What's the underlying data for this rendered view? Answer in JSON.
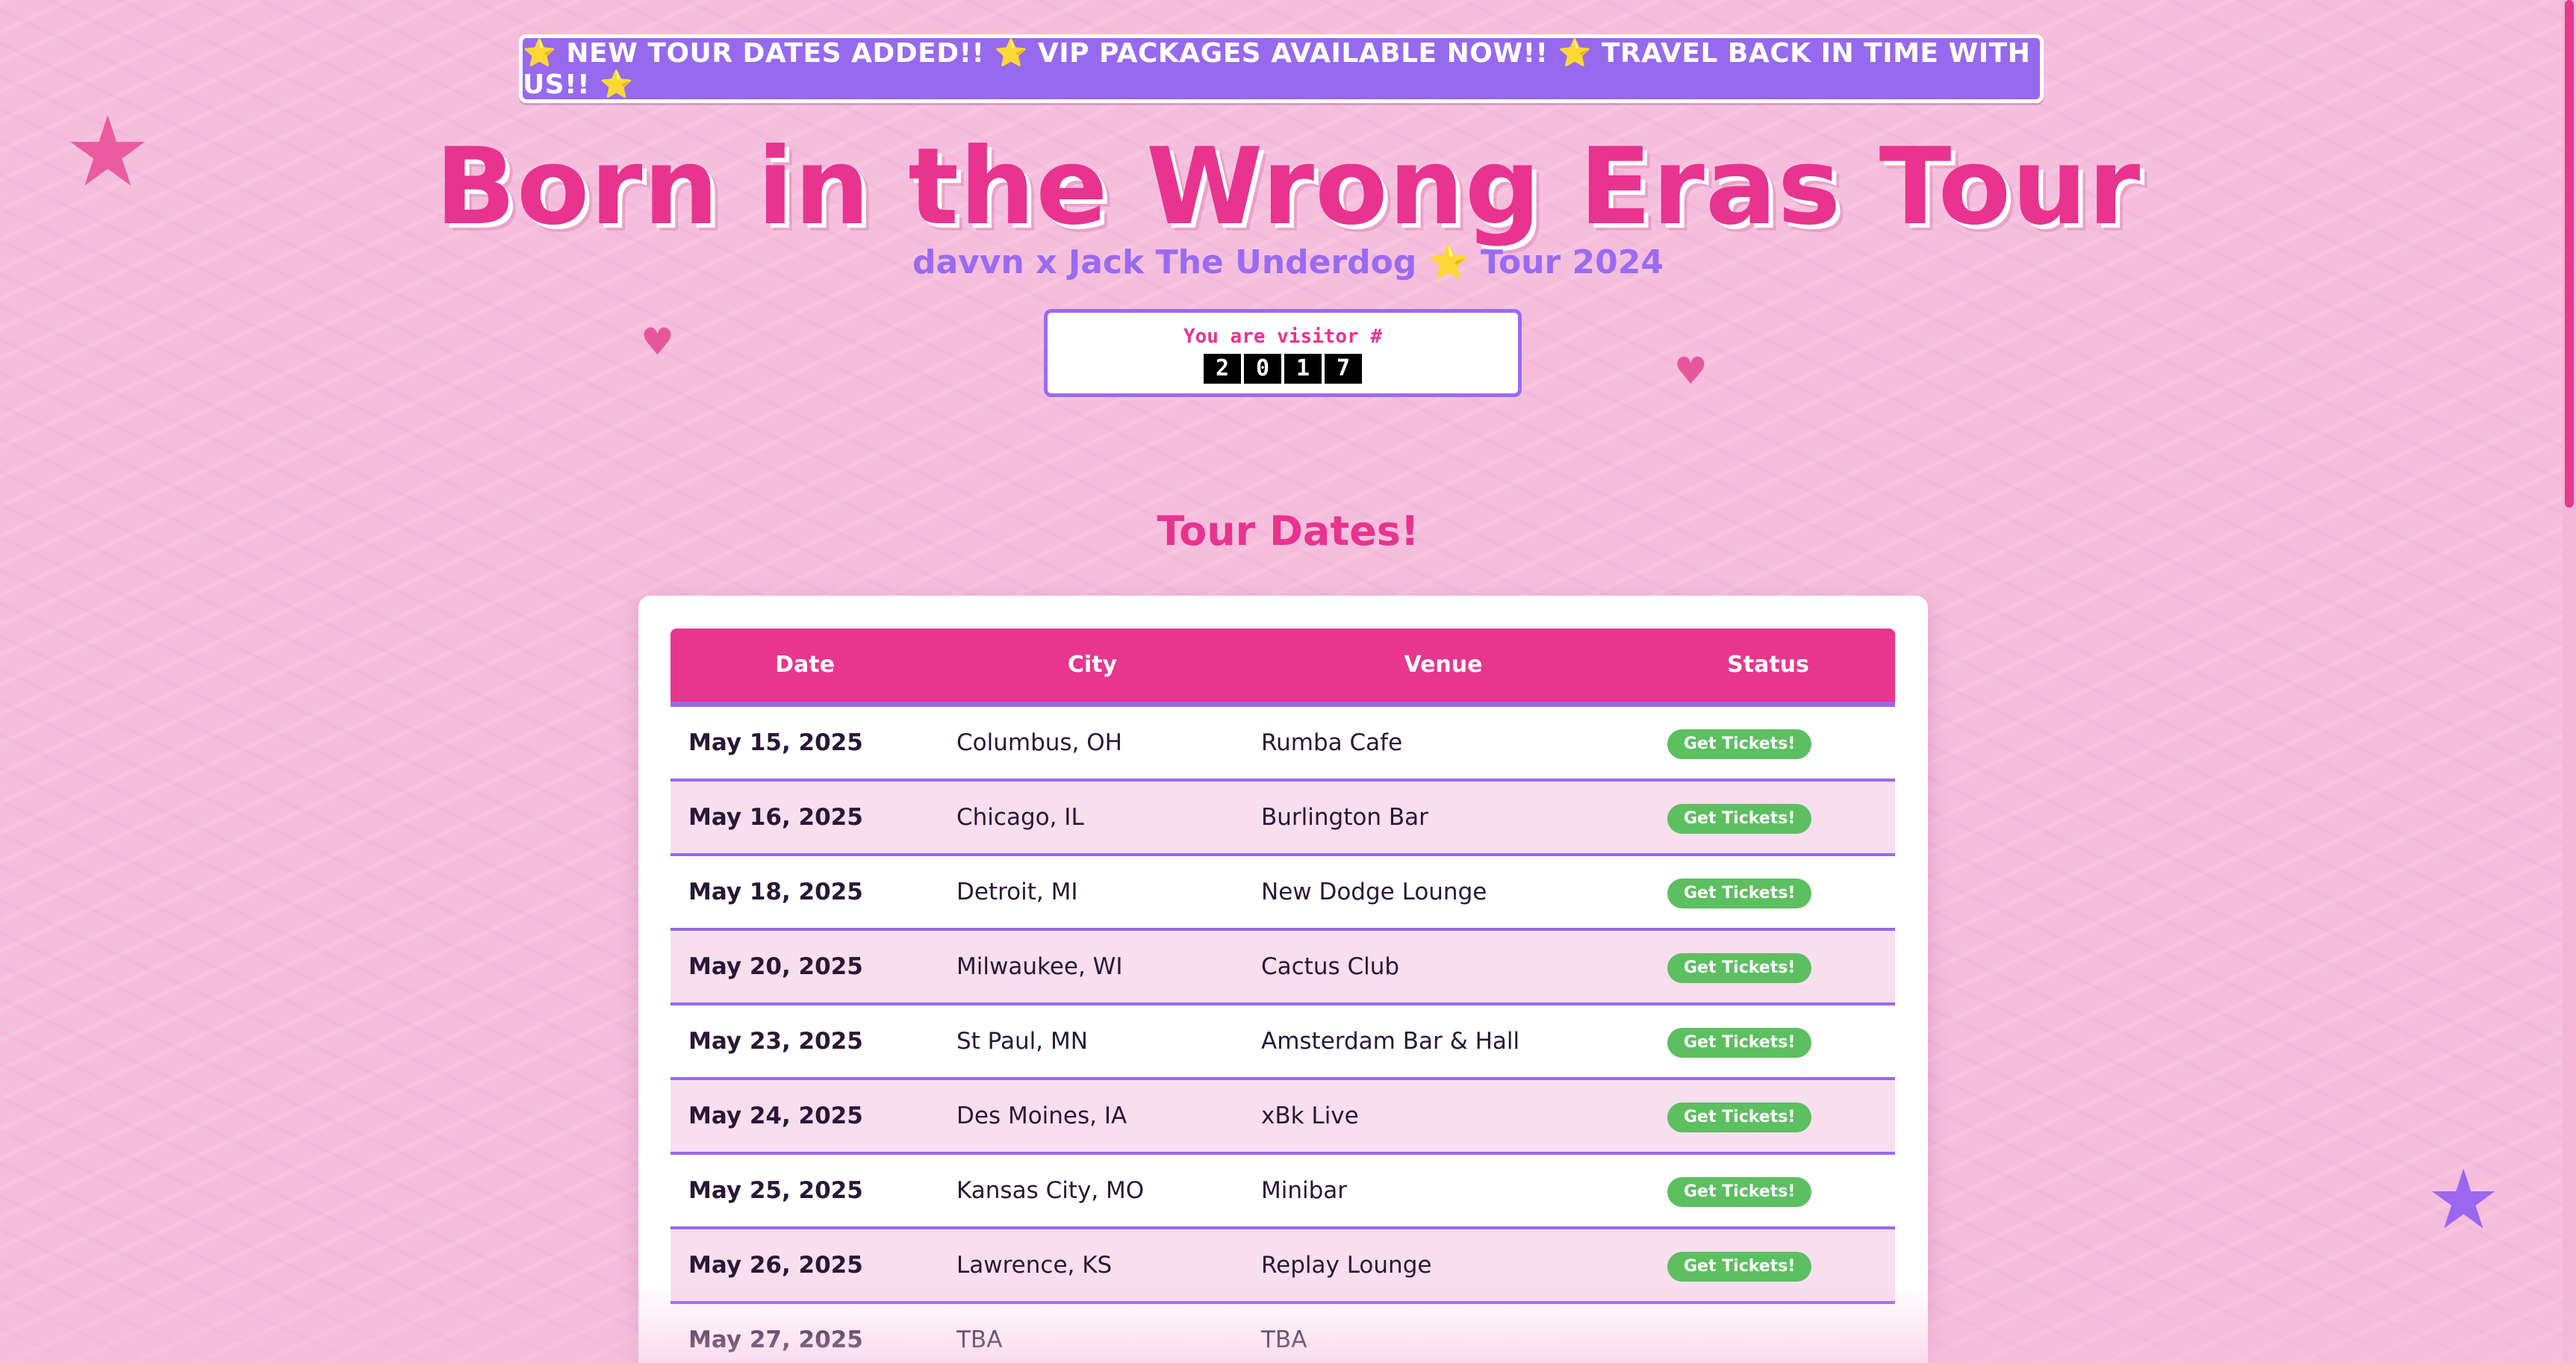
{
  "banner": {
    "text": "⭐ NEW TOUR DATES ADDED!! ⭐ VIP PACKAGES AVAILABLE NOW!! ⭐ TRAVEL BACK IN TIME WITH US!! ⭐"
  },
  "header": {
    "title": "Born in the Wrong Eras Tour",
    "subtitle": "davvn x Jack The Underdog ⭐ Tour 2024"
  },
  "visitor_counter": {
    "label": "You are visitor #",
    "digits": [
      "2",
      "0",
      "1",
      "7"
    ]
  },
  "decorations": {
    "star": "★",
    "heart": "♥",
    "star_pink_color": "#ea5ba0",
    "star_purple_color": "#9c67f0"
  },
  "tour": {
    "section_title": "Tour Dates!",
    "columns": [
      "Date",
      "City",
      "Venue",
      "Status"
    ],
    "rows": [
      {
        "date": "May 15, 2025",
        "city": "Columbus, OH",
        "venue": "Rumba Cafe",
        "status": "Get Tickets!"
      },
      {
        "date": "May 16, 2025",
        "city": "Chicago, IL",
        "venue": "Burlington Bar",
        "status": "Get Tickets!"
      },
      {
        "date": "May 18, 2025",
        "city": "Detroit, MI",
        "venue": "New Dodge Lounge",
        "status": "Get Tickets!"
      },
      {
        "date": "May 20, 2025",
        "city": "Milwaukee, WI",
        "venue": "Cactus Club",
        "status": "Get Tickets!"
      },
      {
        "date": "May 23, 2025",
        "city": "St Paul, MN",
        "venue": "Amsterdam Bar & Hall",
        "status": "Get Tickets!"
      },
      {
        "date": "May 24, 2025",
        "city": "Des Moines, IA",
        "venue": "xBk Live",
        "status": "Get Tickets!"
      },
      {
        "date": "May 25, 2025",
        "city": "Kansas City, MO",
        "venue": "Minibar",
        "status": "Get Tickets!"
      },
      {
        "date": "May 26, 2025",
        "city": "Lawrence, KS",
        "venue": "Replay Lounge",
        "status": "Get Tickets!"
      },
      {
        "date": "May 27, 2025",
        "city": "TBA",
        "venue": "TBA",
        "status": ""
      }
    ]
  },
  "colors": {
    "accent_pink": "#e8338f",
    "accent_purple": "#9669ef",
    "ticket_green": "#5cbf60",
    "background": "#f6bedd"
  }
}
